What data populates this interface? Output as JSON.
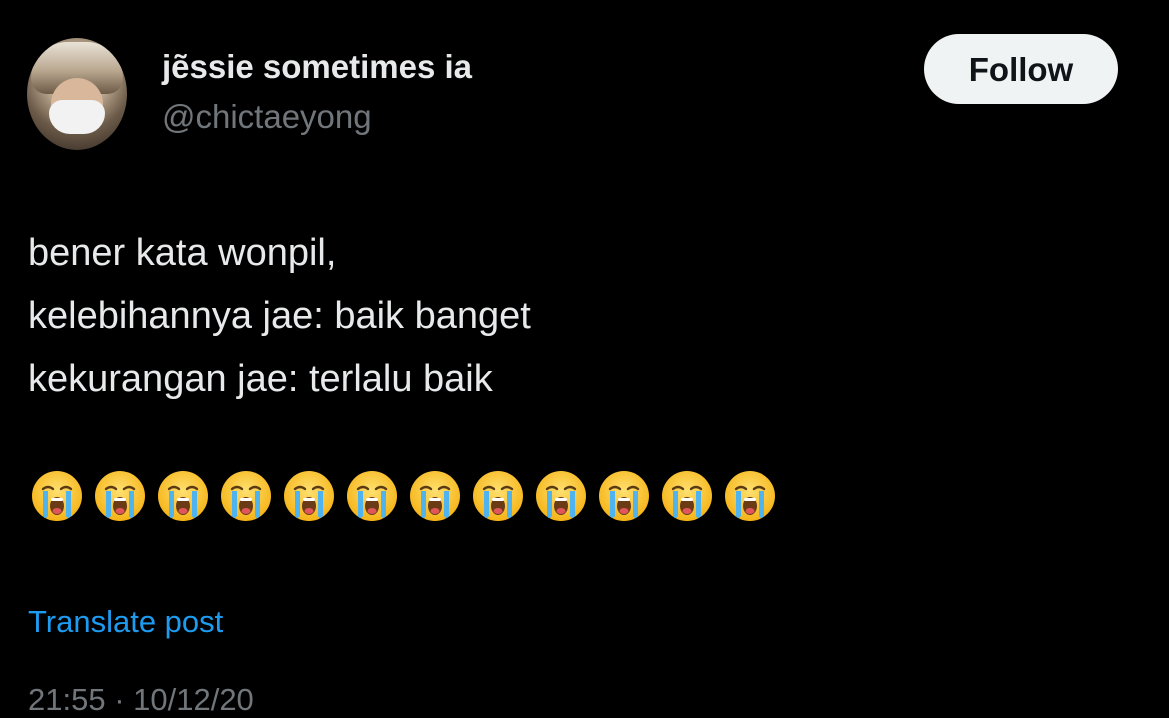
{
  "author": {
    "display_name": "jẽssie sometimes ia",
    "handle": "@chictaeyong",
    "avatar_icon": "profile-photo-masked-person"
  },
  "follow_button": {
    "label": "Follow"
  },
  "tweet": {
    "lines": [
      "bener kata wonpil,",
      "kelebihannya jae: baik banget",
      "kekurangan jae: terlalu baik"
    ],
    "emoji_count": 12,
    "emoji_name": "loudly-crying-face"
  },
  "translate": {
    "label": "Translate post"
  },
  "timestamp": {
    "text": "21:55 · 10/12/20"
  },
  "colors": {
    "background": "#000000",
    "primary_text": "#e7e9ea",
    "secondary_text": "#71767b",
    "link": "#1d9bf0",
    "follow_bg": "#eff3f4"
  }
}
